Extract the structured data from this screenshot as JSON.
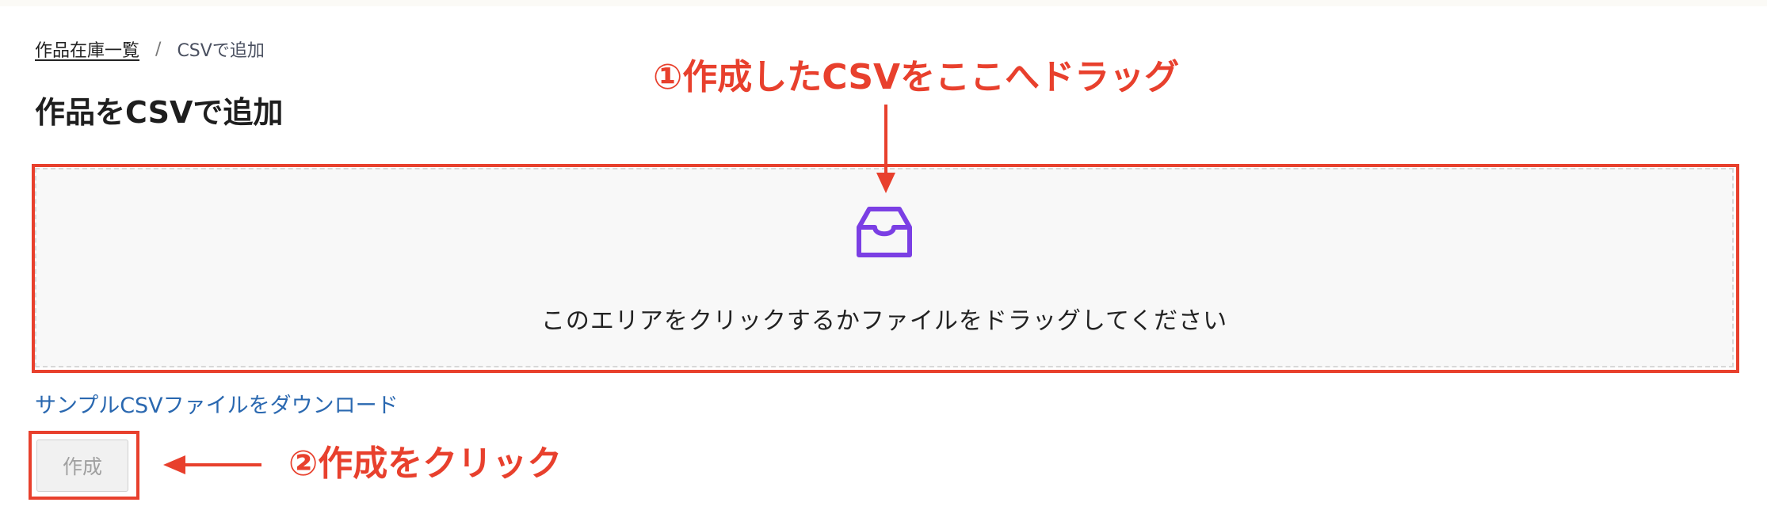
{
  "breadcrumb": {
    "parent": "作品在庫一覧",
    "separator": "/",
    "current": "CSVで追加"
  },
  "page": {
    "title": "作品をCSVで追加"
  },
  "dropzone": {
    "icon": "inbox-icon",
    "text": "このエリアをクリックするかファイルをドラッグしてください"
  },
  "sample_link": "サンプルCSVファイルをダウンロード",
  "create_button": {
    "label": "作成",
    "disabled": true
  },
  "annotations": {
    "step1": "①作成したCSVをここへドラッグ",
    "step2": "②作成をクリック"
  },
  "colors": {
    "annotation": "#e8402d",
    "icon": "#7b3fe4",
    "link": "#2a68b0"
  }
}
